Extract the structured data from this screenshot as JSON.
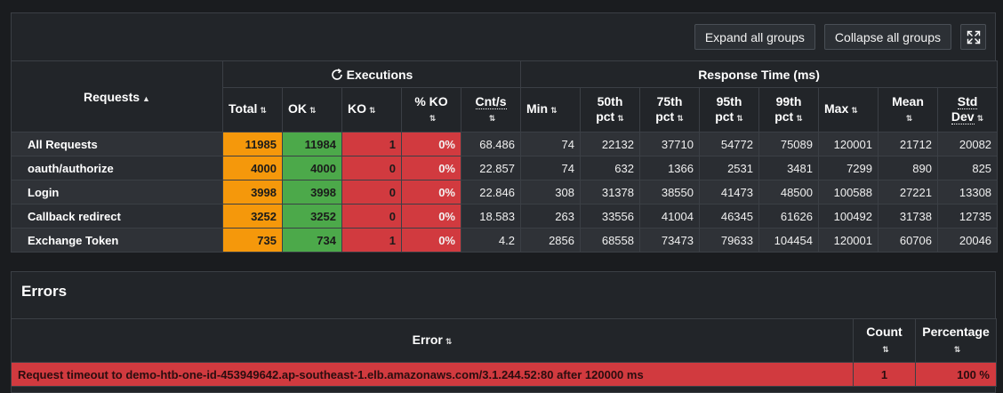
{
  "toolbar": {
    "expand_label": "Expand all groups",
    "collapse_label": "Collapse all groups",
    "fullscreen_icon": "expand-icon"
  },
  "stats": {
    "group_headers": {
      "requests": "Requests",
      "executions": "Executions",
      "response_time": "Response Time (ms)"
    },
    "columns": {
      "total": "Total",
      "ok": "OK",
      "ko": "KO",
      "pct_ko": "% KO",
      "cnt_s": "Cnt/s",
      "min": "Min",
      "p50_a": "50th",
      "p50_b": "pct",
      "p75_a": "75th",
      "p75_b": "pct",
      "p95_a": "95th",
      "p95_b": "pct",
      "p99_a": "99th",
      "p99_b": "pct",
      "max": "Max",
      "mean": "Mean",
      "std_a": "Std",
      "std_b": "Dev"
    },
    "rows": [
      {
        "name": "All Requests",
        "total": "11985",
        "ok": "11984",
        "ko": "1",
        "pct_ko": "0%",
        "cnt_s": "68.486",
        "min": "74",
        "p50": "22132",
        "p75": "37710",
        "p95": "54772",
        "p99": "75089",
        "max": "120001",
        "mean": "21712",
        "std": "20082"
      },
      {
        "name": "oauth/authorize",
        "total": "4000",
        "ok": "4000",
        "ko": "0",
        "pct_ko": "0%",
        "cnt_s": "22.857",
        "min": "74",
        "p50": "632",
        "p75": "1366",
        "p95": "2531",
        "p99": "3481",
        "max": "7299",
        "mean": "890",
        "std": "825"
      },
      {
        "name": "Login",
        "total": "3998",
        "ok": "3998",
        "ko": "0",
        "pct_ko": "0%",
        "cnt_s": "22.846",
        "min": "308",
        "p50": "31378",
        "p75": "38550",
        "p95": "41473",
        "p99": "48500",
        "max": "100588",
        "mean": "27221",
        "std": "13308"
      },
      {
        "name": "Callback redirect",
        "total": "3252",
        "ok": "3252",
        "ko": "0",
        "pct_ko": "0%",
        "cnt_s": "18.583",
        "min": "263",
        "p50": "33556",
        "p75": "41004",
        "p95": "46345",
        "p99": "61626",
        "max": "100492",
        "mean": "31738",
        "std": "12735"
      },
      {
        "name": "Exchange Token",
        "total": "735",
        "ok": "734",
        "ko": "1",
        "pct_ko": "0%",
        "cnt_s": "4.2",
        "min": "2856",
        "p50": "68558",
        "p75": "73473",
        "p95": "79633",
        "p99": "104454",
        "max": "120001",
        "mean": "60706",
        "std": "20046"
      }
    ]
  },
  "errors": {
    "title": "Errors",
    "headers": {
      "error": "Error",
      "count": "Count",
      "percentage": "Percentage"
    },
    "rows": [
      {
        "message": "Request timeout to demo-htb-one-id-453949642.ap-southeast-1.elb.amazonaws.com/3.1.244.52:80 after 120000 ms",
        "count": "1",
        "percentage": "100 %"
      }
    ]
  },
  "colors": {
    "total": "#f5980b",
    "ok": "#4ca94a",
    "ko": "#d13a3f",
    "panel": "#222529",
    "background": "#1a1c1f"
  }
}
